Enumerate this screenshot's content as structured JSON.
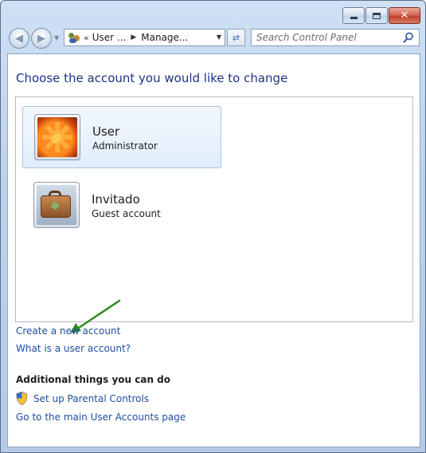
{
  "window": {
    "minimize_icon": "minimize-icon",
    "maximize_icon": "maximize-icon",
    "close_icon": "close-icon"
  },
  "address": {
    "overflow": "«",
    "crumbs": [
      "User ...",
      "Manage..."
    ],
    "icon": "user-accounts-icon"
  },
  "search": {
    "placeholder": "Search Control Panel",
    "icon": "search-icon"
  },
  "main": {
    "heading": "Choose the account you would like to change",
    "accounts": [
      {
        "name": "User",
        "role": "Administrator",
        "avatar": "flower-avatar",
        "selected": true
      },
      {
        "name": "Invitado",
        "role": "Guest account",
        "avatar": "briefcase-avatar",
        "selected": false
      }
    ],
    "links": {
      "create": "Create a new account",
      "what": "What is a user account?"
    },
    "additional": {
      "title": "Additional things you can do",
      "parental": "Set up Parental Controls",
      "main_page": "Go to the main User Accounts page"
    }
  },
  "colors": {
    "heading": "#1e3287",
    "link": "#1f4ea1",
    "annotation_arrow": "#2e8b1f"
  }
}
